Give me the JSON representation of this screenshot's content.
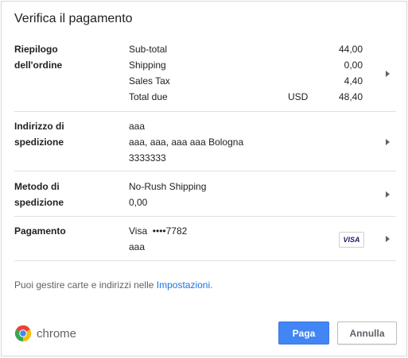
{
  "dialog": {
    "title": "Verifica il pagamento"
  },
  "order_summary": {
    "label_line1": "Riepilogo",
    "label_line2": "dell'ordine",
    "rows": [
      {
        "label": "Sub-total",
        "currency": "",
        "amount": "44,00"
      },
      {
        "label": "Shipping",
        "currency": "",
        "amount": "0,00"
      },
      {
        "label": "Sales Tax",
        "currency": "",
        "amount": "4,40"
      },
      {
        "label": "Total due",
        "currency": "USD",
        "amount": "48,40"
      }
    ]
  },
  "shipping_address": {
    "label_line1": "Indirizzo di",
    "label_line2": "spedizione",
    "name": "aaa",
    "address": "aaa, aaa, aaa aaa Bologna",
    "phone": "3333333"
  },
  "shipping_method": {
    "label_line1": "Metodo di",
    "label_line2": "spedizione",
    "method": "No-Rush Shipping",
    "price": "0,00"
  },
  "payment": {
    "label": "Pagamento",
    "card": "Visa  ••••7782",
    "holder": "aaa",
    "card_logo": "VISA"
  },
  "footnote": {
    "text": "Puoi gestire carte e indirizzi nelle ",
    "link": "Impostazioni",
    "suffix": "."
  },
  "brand": {
    "name": "chrome"
  },
  "buttons": {
    "pay": "Paga",
    "cancel": "Annulla"
  },
  "colors": {
    "primary": "#4285f4",
    "link": "#1a73e8",
    "divider": "#e0e0e0"
  }
}
